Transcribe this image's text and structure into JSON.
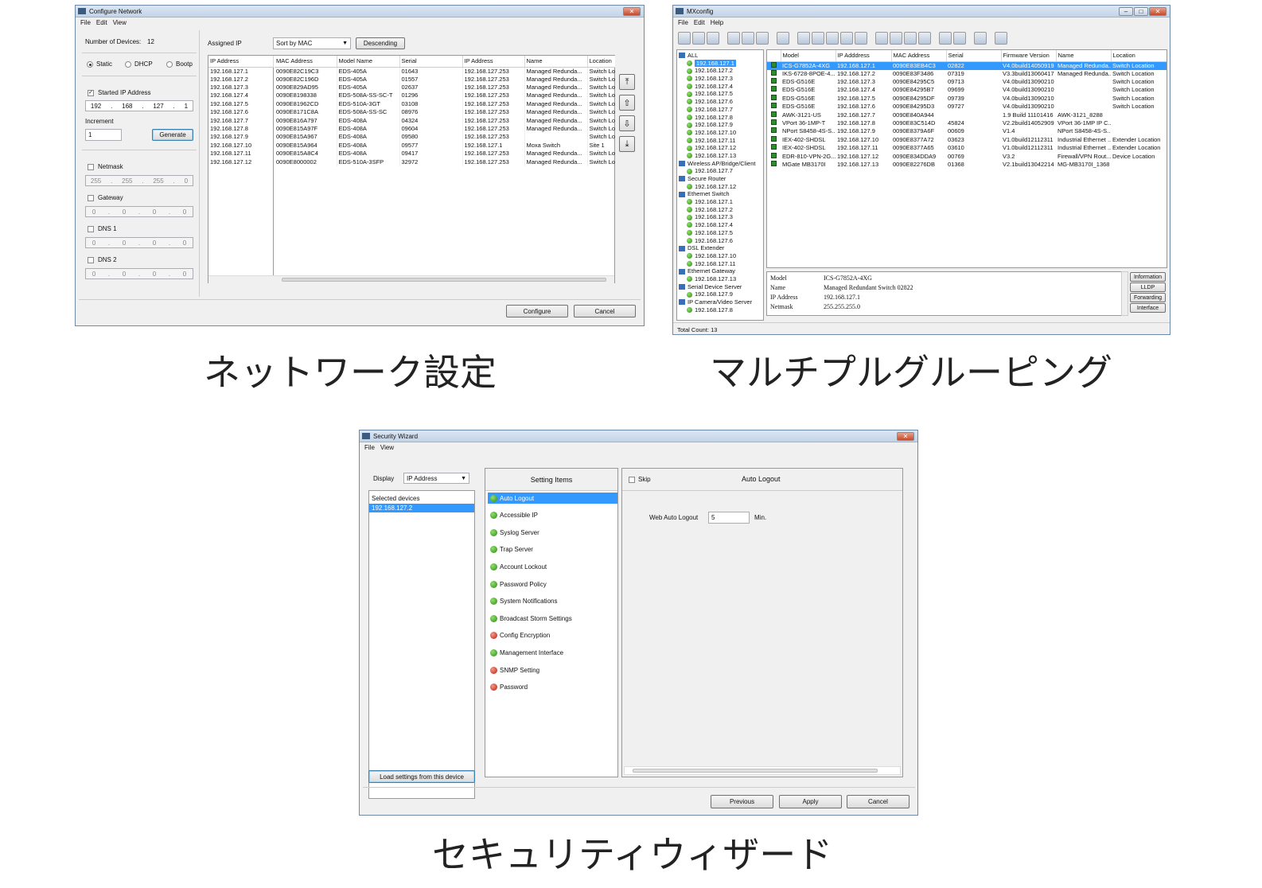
{
  "captions": {
    "network": "ネットワーク設定",
    "grouping": "マルチプルグルーピング",
    "security": "セキュリティウィザード"
  },
  "configure": {
    "title": "Configure Network",
    "menu": [
      "File",
      "Edit",
      "View"
    ],
    "num_devices_label": "Number of Devices:",
    "num_devices": "12",
    "radio_static": "Static",
    "radio_dhcp": "DHCP",
    "radio_bootp": "Bootp",
    "started_ip_label": "Started IP Address",
    "started_ip": [
      "192",
      "168",
      "127",
      "1"
    ],
    "increment_label": "Increment",
    "increment": "1",
    "generate": "Generate",
    "netmask_label": "Netmask",
    "netmask": [
      "255",
      "255",
      "255",
      "0"
    ],
    "gateway_label": "Gateway",
    "gateway": [
      "0",
      "0",
      "0",
      "0"
    ],
    "dns1_label": "DNS 1",
    "dns1": [
      "0",
      "0",
      "0",
      "0"
    ],
    "dns2_label": "DNS 2",
    "dns2": [
      "0",
      "0",
      "0",
      "0"
    ],
    "assigned_ip_label": "Assigned IP",
    "sort_value": "Sort by MAC",
    "descending": "Descending",
    "left_header": "IP Address",
    "headers": [
      "MAC Address",
      "Model Name",
      "Serial",
      "IP Address",
      "Name",
      "Location"
    ],
    "rows": [
      [
        "192.168.127.1",
        "0090E82C19C3",
        "EDS-405A",
        "01643",
        "192.168.127.253",
        "Managed Redunda...",
        "Switch Lo"
      ],
      [
        "192.168.127.2",
        "0090E82C196D",
        "EDS-405A",
        "01557",
        "192.168.127.253",
        "Managed Redunda...",
        "Switch Lo"
      ],
      [
        "192.168.127.3",
        "0090E829AD95",
        "EDS-405A",
        "02637",
        "192.168.127.253",
        "Managed Redunda...",
        "Switch Lo"
      ],
      [
        "192.168.127.4",
        "0090E8198338",
        "EDS-508A-SS-SC-T",
        "01296",
        "192.168.127.253",
        "Managed Redunda...",
        "Switch Lo"
      ],
      [
        "192.168.127.5",
        "0090E81962CD",
        "EDS-510A-3GT",
        "03108",
        "192.168.127.253",
        "Managed Redunda...",
        "Switch Lo"
      ],
      [
        "192.168.127.6",
        "0090E8171C8A",
        "EDS-508A-SS-SC",
        "08976",
        "192.168.127.253",
        "Managed Redunda...",
        "Switch Lo"
      ],
      [
        "192.168.127.7",
        "0090E816A797",
        "EDS-408A",
        "04324",
        "192.168.127.253",
        "Managed Redunda...",
        "Switch Lo"
      ],
      [
        "192.168.127.8",
        "0090E815A97F",
        "EDS-408A",
        "09604",
        "192.168.127.253",
        "Managed Redunda...",
        "Switch Lo"
      ],
      [
        "192.168.127.9",
        "0090E815A967",
        "EDS-408A",
        "09580",
        "192.168.127.253",
        "",
        "Switch Lo"
      ],
      [
        "192.168.127.10",
        "0090E815A964",
        "EDS-408A",
        "09577",
        "192.168.127.1",
        "Moxa Switch",
        "Site 1"
      ],
      [
        "192.168.127.11",
        "0090E815A8C4",
        "EDS-408A",
        "09417",
        "192.168.127.253",
        "Managed Redunda...",
        "Switch Lo"
      ],
      [
        "192.168.127.12",
        "0090E8000002",
        "EDS-510A-3SFP",
        "32972",
        "192.168.127.253",
        "Managed Redunda...",
        "Switch Lo"
      ]
    ],
    "configure_btn": "Configure",
    "cancel_btn": "Cancel"
  },
  "mxconfig": {
    "title": "MXconfig",
    "menu": [
      "File",
      "Edit",
      "Help"
    ],
    "tree": [
      {
        "t": "group",
        "label": "ALL"
      },
      {
        "t": "dev",
        "label": "192.168.127.1",
        "sel": true
      },
      {
        "t": "dev",
        "label": "192.168.127.2"
      },
      {
        "t": "dev",
        "label": "192.168.127.3"
      },
      {
        "t": "dev",
        "label": "192.168.127.4"
      },
      {
        "t": "dev",
        "label": "192.168.127.5"
      },
      {
        "t": "dev",
        "label": "192.168.127.6"
      },
      {
        "t": "dev",
        "label": "192.168.127.7"
      },
      {
        "t": "dev",
        "label": "192.168.127.8"
      },
      {
        "t": "dev",
        "label": "192.168.127.9"
      },
      {
        "t": "dev",
        "label": "192.168.127.10"
      },
      {
        "t": "dev",
        "label": "192.168.127.11"
      },
      {
        "t": "dev",
        "label": "192.168.127.12"
      },
      {
        "t": "dev",
        "label": "192.168.127.13"
      },
      {
        "t": "group",
        "label": "Wireless AP/Bridge/Client"
      },
      {
        "t": "dev",
        "label": "192.168.127.7"
      },
      {
        "t": "group",
        "label": "Secure Router"
      },
      {
        "t": "dev",
        "label": "192.168.127.12"
      },
      {
        "t": "group",
        "label": "Ethernet Switch"
      },
      {
        "t": "dev",
        "label": "192.168.127.1"
      },
      {
        "t": "dev",
        "label": "192.168.127.2"
      },
      {
        "t": "dev",
        "label": "192.168.127.3"
      },
      {
        "t": "dev",
        "label": "192.168.127.4"
      },
      {
        "t": "dev",
        "label": "192.168.127.5"
      },
      {
        "t": "dev",
        "label": "192.168.127.6"
      },
      {
        "t": "group",
        "label": "DSL Extender"
      },
      {
        "t": "dev",
        "label": "192.168.127.10"
      },
      {
        "t": "dev",
        "label": "192.168.127.11"
      },
      {
        "t": "group",
        "label": "Ethernet Gateway"
      },
      {
        "t": "dev",
        "label": "192.168.127.13"
      },
      {
        "t": "group",
        "label": "Serial Device Server"
      },
      {
        "t": "dev",
        "label": "192.168.127.9"
      },
      {
        "t": "group",
        "label": "IP Camera/Video Server"
      },
      {
        "t": "dev",
        "label": "192.168.127.8"
      }
    ],
    "headers": [
      "Model",
      "IP Adddress",
      "MAC Address",
      "Serial",
      "Firmware Version",
      "Name",
      "Location"
    ],
    "rows": [
      [
        "ICS-G7852A-4XG",
        "192.168.127.1",
        "0090E83EB4C3",
        "02822",
        "V4.0build14050919",
        "Managed Redunda...",
        "Switch Location"
      ],
      [
        "IKS-6728-8POE-4...",
        "192.168.127.2",
        "0090E83F3486",
        "07319",
        "V3.3build13060417",
        "Managed Redunda...",
        "Switch Location"
      ],
      [
        "EDS-G516E",
        "192.168.127.3",
        "0090E84295C5",
        "09713",
        "V4.0build13090210",
        "",
        "Switch Location"
      ],
      [
        "EDS-G516E",
        "192.168.127.4",
        "0090E84295B7",
        "09699",
        "V4.0build13090210",
        "",
        "Switch Location"
      ],
      [
        "EDS-G516E",
        "192.168.127.5",
        "0090E84295DF",
        "09739",
        "V4.0build13090210",
        "",
        "Switch Location"
      ],
      [
        "EDS-G516E",
        "192.168.127.6",
        "0090E84295D3",
        "09727",
        "V4.0build13090210",
        "",
        "Switch Location"
      ],
      [
        "AWK-3121-US",
        "192.168.127.7",
        "0090E840A944",
        "",
        "1.9 Build 11101416",
        "AWK-3121_8288",
        ""
      ],
      [
        "VPort 36-1MP-T",
        "192.168.127.8",
        "0090E83C514D",
        "45824",
        "V2.2build14052909",
        "VPort 36-1MP IP C...",
        ""
      ],
      [
        "NPort S8458-4S-S...",
        "192.168.127.9",
        "0090E8379A6F",
        "00609",
        "V1.4",
        "NPort S8458-4S-S...",
        ""
      ],
      [
        "IEX-402-SHDSL",
        "192.168.127.10",
        "0090E8377A72",
        "03623",
        "V1.0build12112311",
        "Industrial Ethernet ...",
        "Extender Location"
      ],
      [
        "IEX-402-SHDSL",
        "192.168.127.11",
        "0090E8377A65",
        "03610",
        "V1.0build12112311",
        "Industrial Ethernet ...",
        "Extender Location"
      ],
      [
        "EDR-810-VPN-2G...",
        "192.168.127.12",
        "0090E834DDA9",
        "00769",
        "V3.2",
        "Firewall/VPN Rout...",
        "Device Location"
      ],
      [
        "MGate MB3170I",
        "192.168.127.13",
        "0090E82276DB",
        "01368",
        "V2.1build13042214",
        "MG-MB3170I_1368",
        ""
      ]
    ],
    "info": [
      [
        "Model",
        "ICS-G7852A-4XG"
      ],
      [
        "Name",
        "Managed Redundant Switch 02822"
      ],
      [
        "IP Address",
        "192.168.127.1"
      ],
      [
        "Netmask",
        "255.255.255.0"
      ]
    ],
    "side_buttons": [
      "Information",
      "LLDP",
      "Forwarding",
      "Interface"
    ],
    "total_count": "Total Count: 13"
  },
  "wizard": {
    "title": "Security Wizard",
    "menu": [
      "File",
      "View"
    ],
    "display_label": "Display",
    "display_value": "IP Address",
    "selected_devices_label": "Selected devices",
    "selected_device": "192.168.127.2",
    "load_btn": "Load settings from this device",
    "setting_items_label": "Setting Items",
    "items": [
      {
        "label": "Auto Logout",
        "status": "green",
        "sel": true
      },
      {
        "label": "Accessible IP",
        "status": "green"
      },
      {
        "label": "Syslog Server",
        "status": "green"
      },
      {
        "label": "Trap Server",
        "status": "green"
      },
      {
        "label": "Account Lockout",
        "status": "green"
      },
      {
        "label": "Password Policy",
        "status": "green"
      },
      {
        "label": "System Notifications",
        "status": "green"
      },
      {
        "label": "Broadcast Storm Settings",
        "status": "green"
      },
      {
        "label": "Config Encryption",
        "status": "red"
      },
      {
        "label": "Management Interface",
        "status": "green"
      },
      {
        "label": "SNMP Setting",
        "status": "red"
      },
      {
        "label": "Password",
        "status": "red"
      }
    ],
    "skip_label": "Skip",
    "panel_title": "Auto Logout",
    "web_auto_logout_label": "Web Auto Logout",
    "web_auto_logout_value": "5",
    "unit": "Min.",
    "previous_btn": "Previous",
    "apply_btn": "Apply",
    "cancel_btn": "Cancel"
  }
}
